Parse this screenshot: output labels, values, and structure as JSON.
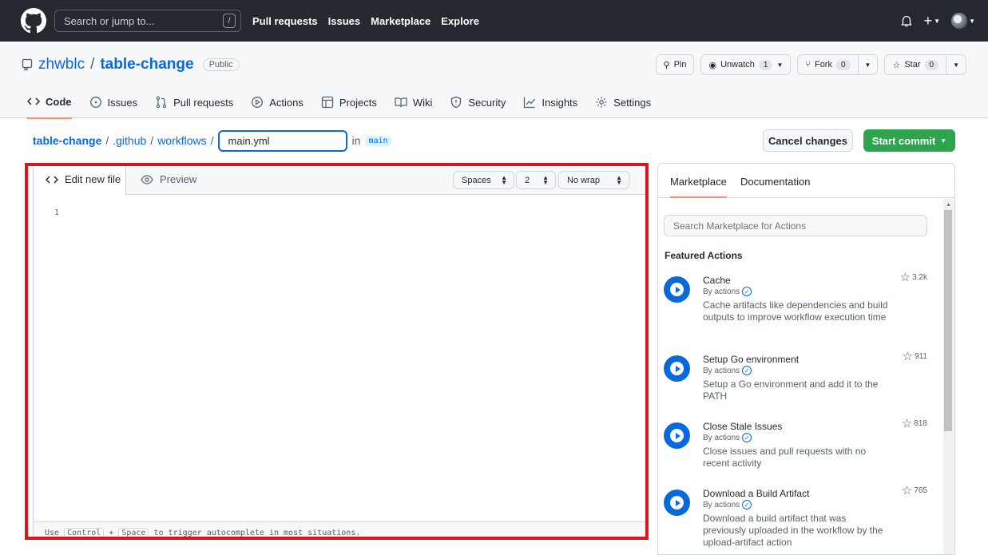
{
  "header": {
    "search_placeholder": "Search or jump to...",
    "search_key": "/",
    "nav": [
      "Pull requests",
      "Issues",
      "Marketplace",
      "Explore"
    ]
  },
  "repo": {
    "owner": "zhwblc",
    "separator": "/",
    "name": "table-change",
    "visibility": "Public",
    "pin_label": "Pin",
    "unwatch_label": "Unwatch",
    "unwatch_count": "1",
    "fork_label": "Fork",
    "fork_count": "0",
    "star_label": "Star",
    "star_count": "0",
    "tabs": [
      {
        "label": "Code",
        "icon": "code-icon",
        "active": true
      },
      {
        "label": "Issues",
        "icon": "issue-icon"
      },
      {
        "label": "Pull requests",
        "icon": "pull-request-icon"
      },
      {
        "label": "Actions",
        "icon": "play-icon"
      },
      {
        "label": "Projects",
        "icon": "table-icon"
      },
      {
        "label": "Wiki",
        "icon": "book-icon"
      },
      {
        "label": "Security",
        "icon": "shield-icon"
      },
      {
        "label": "Insights",
        "icon": "graph-icon"
      },
      {
        "label": "Settings",
        "icon": "gear-icon"
      }
    ]
  },
  "breadcrumb": {
    "root": "table-change",
    "sep": "/",
    "dir1": ".github",
    "dir2": "workflows",
    "filename": "main.yml",
    "in_text": "in",
    "branch": "main"
  },
  "buttons": {
    "cancel": "Cancel changes",
    "commit": "Start commit"
  },
  "editor": {
    "tab_edit": "Edit new file",
    "tab_preview": "Preview",
    "indent_mode": "Spaces",
    "indent_size": "2",
    "wrap_mode": "No wrap",
    "line_number": "1",
    "footer_prefix": "Use",
    "footer_key1": "Control",
    "footer_plus": "+",
    "footer_key2": "Space",
    "footer_suffix": "to trigger autocomplete in most situations."
  },
  "side": {
    "tab_marketplace": "Marketplace",
    "tab_documentation": "Documentation",
    "search_placeholder": "Search Marketplace for Actions",
    "featured_title": "Featured Actions",
    "actions": [
      {
        "name": "Cache",
        "by": "By actions",
        "desc": "Cache artifacts like dependencies and build outputs to improve workflow execution time",
        "stars": "3.2k"
      },
      {
        "name": "Setup Go environment",
        "by": "By actions",
        "desc": "Setup a Go environment and add it to the PATH",
        "stars": "911"
      },
      {
        "name": "Close Stale Issues",
        "by": "By actions",
        "desc": "Close issues and pull requests with no recent activity",
        "stars": "818"
      },
      {
        "name": "Download a Build Artifact",
        "by": "By actions",
        "desc": "Download a build artifact that was previously uploaded in the workflow by the upload-artifact action",
        "stars": "765"
      }
    ]
  },
  "colors": {
    "header_bg": "#24292f",
    "link": "#0969da",
    "commit_green": "#2da44e",
    "highlight_red": "#e0151b",
    "tab_underline": "#fd8c73"
  }
}
